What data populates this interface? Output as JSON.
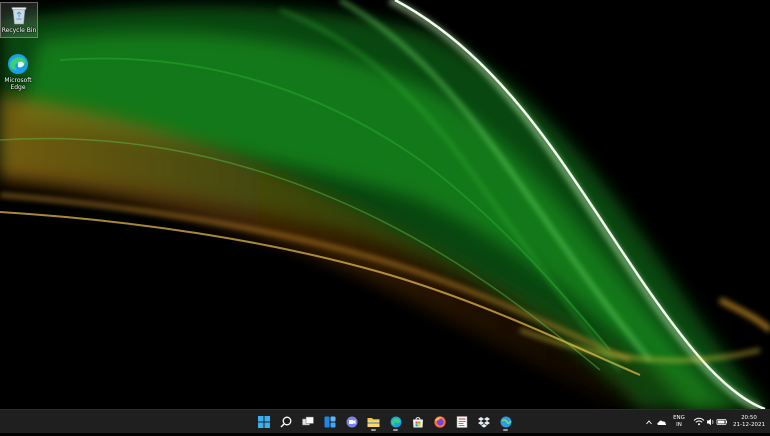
{
  "desktop": {
    "icons": [
      {
        "name": "recycle-bin",
        "label": "Recycle Bin",
        "icon": "recycle-bin-icon"
      },
      {
        "name": "microsoft-edge",
        "label": "Microsoft Edge",
        "icon": "edge-icon"
      }
    ],
    "wallpaper": {
      "description_colors": [
        "#0a8a0a",
        "#3cd43c",
        "#e8ffe0",
        "#c8820a",
        "#6a3a08"
      ]
    }
  },
  "taskbar": {
    "apps": [
      {
        "name": "start",
        "icon": "windows-start-icon",
        "running": false
      },
      {
        "name": "search",
        "icon": "search-icon",
        "running": false
      },
      {
        "name": "task-view",
        "icon": "task-view-icon",
        "running": false
      },
      {
        "name": "widgets",
        "icon": "widgets-icon",
        "running": false
      },
      {
        "name": "chat",
        "icon": "chat-icon",
        "running": false
      },
      {
        "name": "file-explorer",
        "icon": "folder-icon",
        "running": true
      },
      {
        "name": "edge",
        "icon": "edge-icon",
        "running": true
      },
      {
        "name": "microsoft-store",
        "icon": "store-icon",
        "running": false
      },
      {
        "name": "firefox",
        "icon": "firefox-icon",
        "running": false
      },
      {
        "name": "notepad-app",
        "icon": "app-icon",
        "running": false
      },
      {
        "name": "dropbox",
        "icon": "dropbox-icon",
        "running": false
      },
      {
        "name": "web-app",
        "icon": "globe-icon",
        "running": true
      }
    ],
    "tray": {
      "language_line1": "ENG",
      "language_line2": "IN",
      "time": "20:50",
      "date": "21-12-2021"
    }
  },
  "colors": {
    "taskbar_bg": "#1f1f1f",
    "accent": "#0078d4"
  }
}
